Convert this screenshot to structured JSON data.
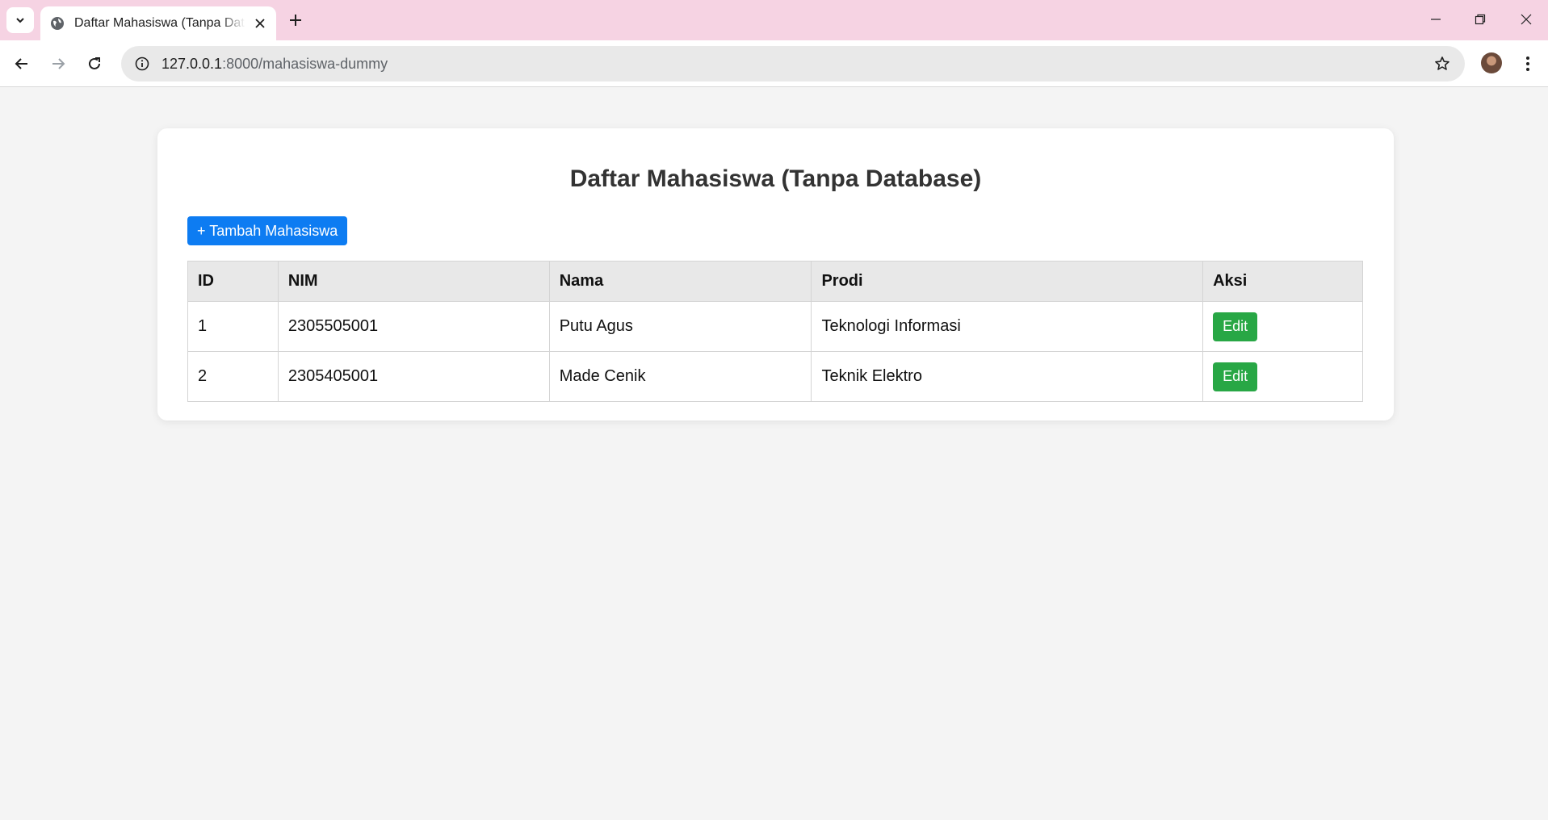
{
  "browser": {
    "tab_title": "Daftar Mahasiswa (Tanpa Database)",
    "url_host": "127.0.0.1",
    "url_path": ":8000/mahasiswa-dummy"
  },
  "page": {
    "title": "Daftar Mahasiswa (Tanpa Database)",
    "add_button": "+ Tambah Mahasiswa",
    "table": {
      "headers": [
        "ID",
        "NIM",
        "Nama",
        "Prodi",
        "Aksi"
      ],
      "rows": [
        {
          "id": "1",
          "nim": "2305505001",
          "nama": "Putu Agus",
          "prodi": "Teknologi Informasi",
          "action": "Edit"
        },
        {
          "id": "2",
          "nim": "2305405001",
          "nama": "Made Cenik",
          "prodi": "Teknik Elektro",
          "action": "Edit"
        }
      ]
    }
  },
  "colors": {
    "primary_button": "#0d7cf2",
    "edit_button": "#28a745",
    "tabstrip": "#f6d3e3"
  }
}
